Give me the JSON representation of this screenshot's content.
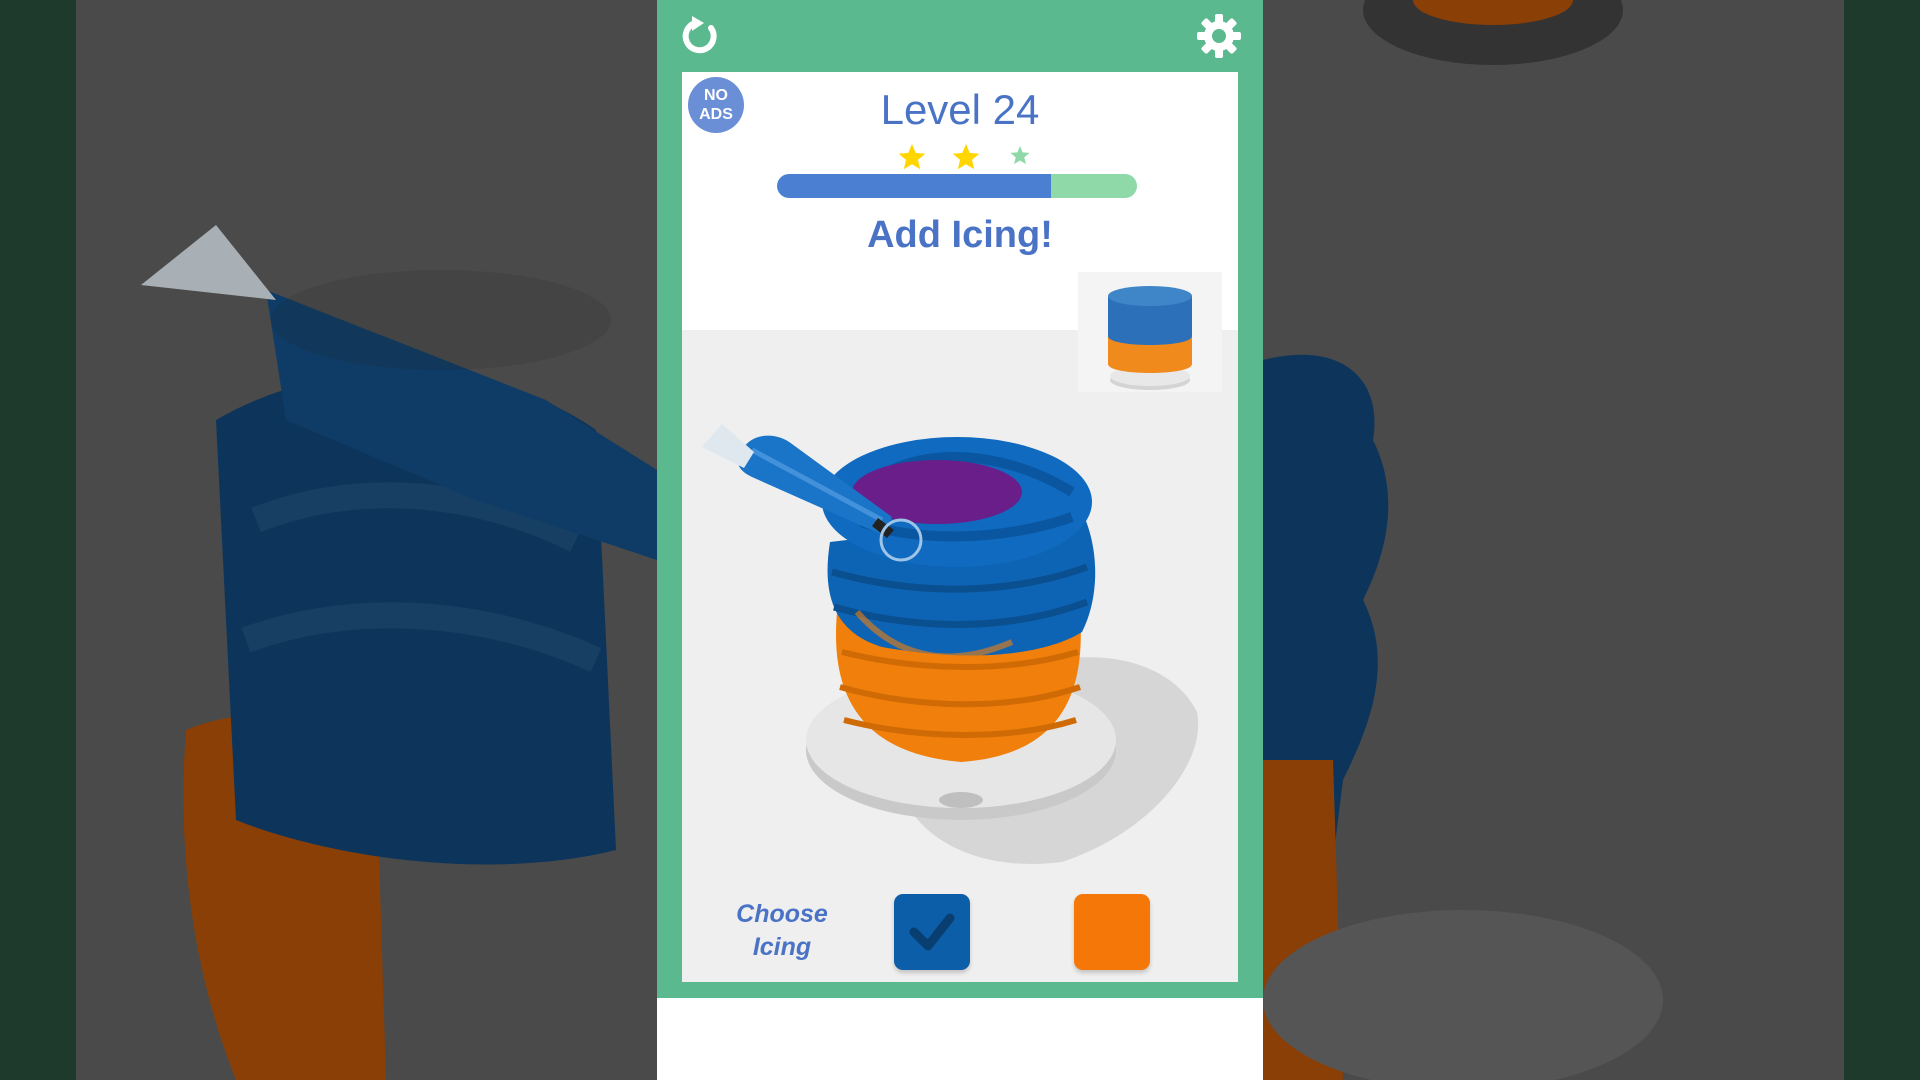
{
  "top_bar": {
    "restart_icon": "restart-icon",
    "settings_icon": "gear-icon"
  },
  "header": {
    "no_ads_line1": "NO",
    "no_ads_line2": "ADS",
    "level_title": "Level 24",
    "stars": {
      "filled": 2,
      "total": 3
    },
    "progress_fraction": 0.76,
    "instruction": "Add Icing!"
  },
  "icing_picker": {
    "label_line1": "Choose",
    "label_line2": "Icing",
    "options": [
      {
        "color": "#0d5ea8",
        "selected": true,
        "icon": "checkmark-icon"
      },
      {
        "color": "#f47708",
        "selected": false
      }
    ]
  },
  "colors": {
    "frame_green": "#5bb98f",
    "accent_blue": "#4a73c6",
    "progress_fill": "#4b7fd2",
    "progress_track": "#8ed9a7",
    "star_filled": "#ffd600",
    "star_empty": "#8ed9a7",
    "icing_blue": "#0d5ea8",
    "cake_orange": "#f47708",
    "jam_purple": "#6a1e8a"
  }
}
